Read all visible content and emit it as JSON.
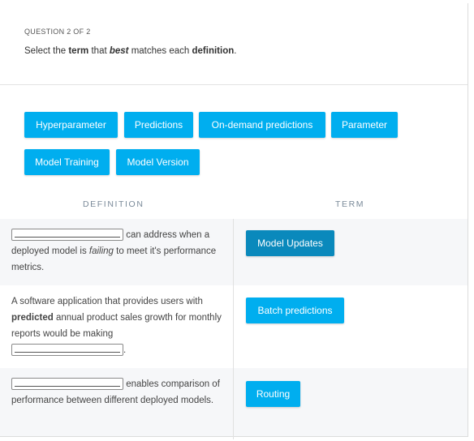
{
  "header": {
    "question_label": "QUESTION 2 OF 2",
    "prompt_before": "Select the ",
    "prompt_term": "term",
    "prompt_middle": " that ",
    "prompt_best": "best",
    "prompt_after": " matches each ",
    "prompt_definition": "definition",
    "prompt_end": "."
  },
  "term_bank": [
    "Hyperparameter",
    "Predictions",
    "On-demand predictions",
    "Parameter",
    "Model Training",
    "Model Version"
  ],
  "columns": {
    "definition": "DEFINITION",
    "term": "TERM"
  },
  "rows": [
    {
      "text_after_blank": " can address when a deployed model is ",
      "italic": "failing",
      "text_end": " to meet it's performance metrics.",
      "term": "Model Updates"
    },
    {
      "text_start": "A software application that provides users with ",
      "bold": "predicted",
      "text_middle": " annual product sales growth for monthly reports would be making ",
      "text_end": ".",
      "term": "Batch predictions"
    },
    {
      "text_after_blank": " enables comparison of performance between different deployed models.",
      "term": "Routing"
    }
  ],
  "colors": {
    "chip": "#00aeef",
    "chip_selected": "#0a89bc",
    "row_shade": "#f6f7f9"
  }
}
